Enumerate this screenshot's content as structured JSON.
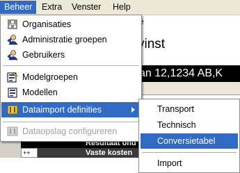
{
  "menubar": {
    "items": [
      {
        "label": "Beheer",
        "active": true
      },
      {
        "label": "Extra",
        "active": false
      },
      {
        "label": "Venster",
        "active": false
      },
      {
        "label": "Help",
        "active": false
      }
    ]
  },
  "background": {
    "link_fragment": "e",
    "title_fragment": "vinst",
    "address_fragment": "an 12,1234 AB,K",
    "row1": "Resultaat ond",
    "row2": "Vaste kosten",
    "cell": "++"
  },
  "menu": {
    "items": [
      {
        "label": "Organisaties",
        "icon": "organization-icon"
      },
      {
        "label": "Administratie groepen",
        "icon": "admin-group-icon"
      },
      {
        "label": "Gebruikers",
        "icon": "users-icon"
      },
      {
        "label": "Modelgroepen",
        "icon": "model-group-icon"
      },
      {
        "label": "Modellen",
        "icon": "models-icon"
      },
      {
        "label": "Dataimport definities",
        "icon": "data-import-icon"
      },
      {
        "label": "Dataopslag configureren",
        "icon": "data-storage-icon"
      }
    ]
  },
  "submenu": {
    "items": [
      {
        "label": "Transport"
      },
      {
        "label": "Technisch"
      },
      {
        "label": "Conversietabel"
      },
      {
        "label": "Import"
      }
    ]
  },
  "colors": {
    "highlight": "#316ac5",
    "menubar_bg": "#ece9d8",
    "disabled_text": "#a0a0a0"
  }
}
